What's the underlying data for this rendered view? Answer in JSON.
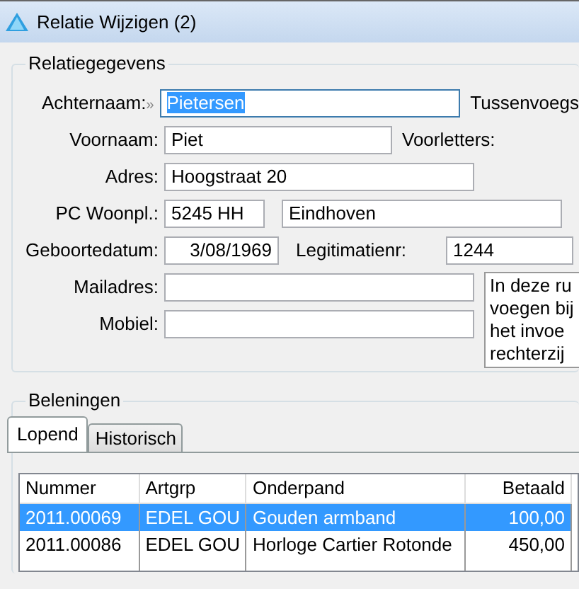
{
  "window": {
    "title": "Relatie Wijzigen  (2)"
  },
  "relatie": {
    "legend": "Relatiegegevens",
    "rows": [
      {
        "label": "Achternaam:",
        "marker": "»",
        "fields": [
          {
            "value": "Pietersen",
            "focused": true
          }
        ],
        "side_label": "Tussenvoegs"
      },
      {
        "label": "Voornaam:",
        "fields": [
          {
            "value": "Piet",
            "focused": false
          }
        ],
        "side_label": "Voorletters:"
      },
      {
        "label": "Adres:",
        "fields": [
          {
            "value": "Hoogstraat 20",
            "focused": false
          }
        ]
      },
      {
        "label": "PC Woonpl.:",
        "fields": [
          {
            "value": "5245 HH",
            "focused": false
          },
          {
            "value": "Eindhoven",
            "focused": false
          }
        ]
      },
      {
        "label": "Geboortedatum:",
        "fields": [
          {
            "value": "3/08/1969",
            "focused": false
          }
        ],
        "mid_label": "Legitimatienr:",
        "mid_field": {
          "value": "1244",
          "focused": false
        }
      },
      {
        "label": "Mailadres:",
        "fields": [
          {
            "focused": false
          }
        ]
      },
      {
        "label": "Mobiel:",
        "fields": [
          {
            "focused": false
          }
        ]
      }
    ],
    "note": [
      "In deze ru",
      "voegen bij",
      "het invoe",
      "rechterzij"
    ]
  },
  "beleningen": {
    "legend": "Beleningen",
    "tabs": [
      {
        "label": "Lopend",
        "selected": true
      },
      {
        "label": "Historisch",
        "selected": false
      }
    ],
    "table": {
      "columns": [
        "Nummer",
        "Artgrp",
        "Onderpand",
        "Betaald"
      ],
      "rows": [
        {
          "cells": [
            "2011.00069",
            "EDEL GOU",
            "Gouden armband",
            "100,00"
          ],
          "selected": true
        },
        {
          "cells": [
            "2011.00086",
            "EDEL GOU",
            "Horloge Cartier Rotonde",
            "450,00"
          ],
          "selected": false
        }
      ]
    }
  }
}
